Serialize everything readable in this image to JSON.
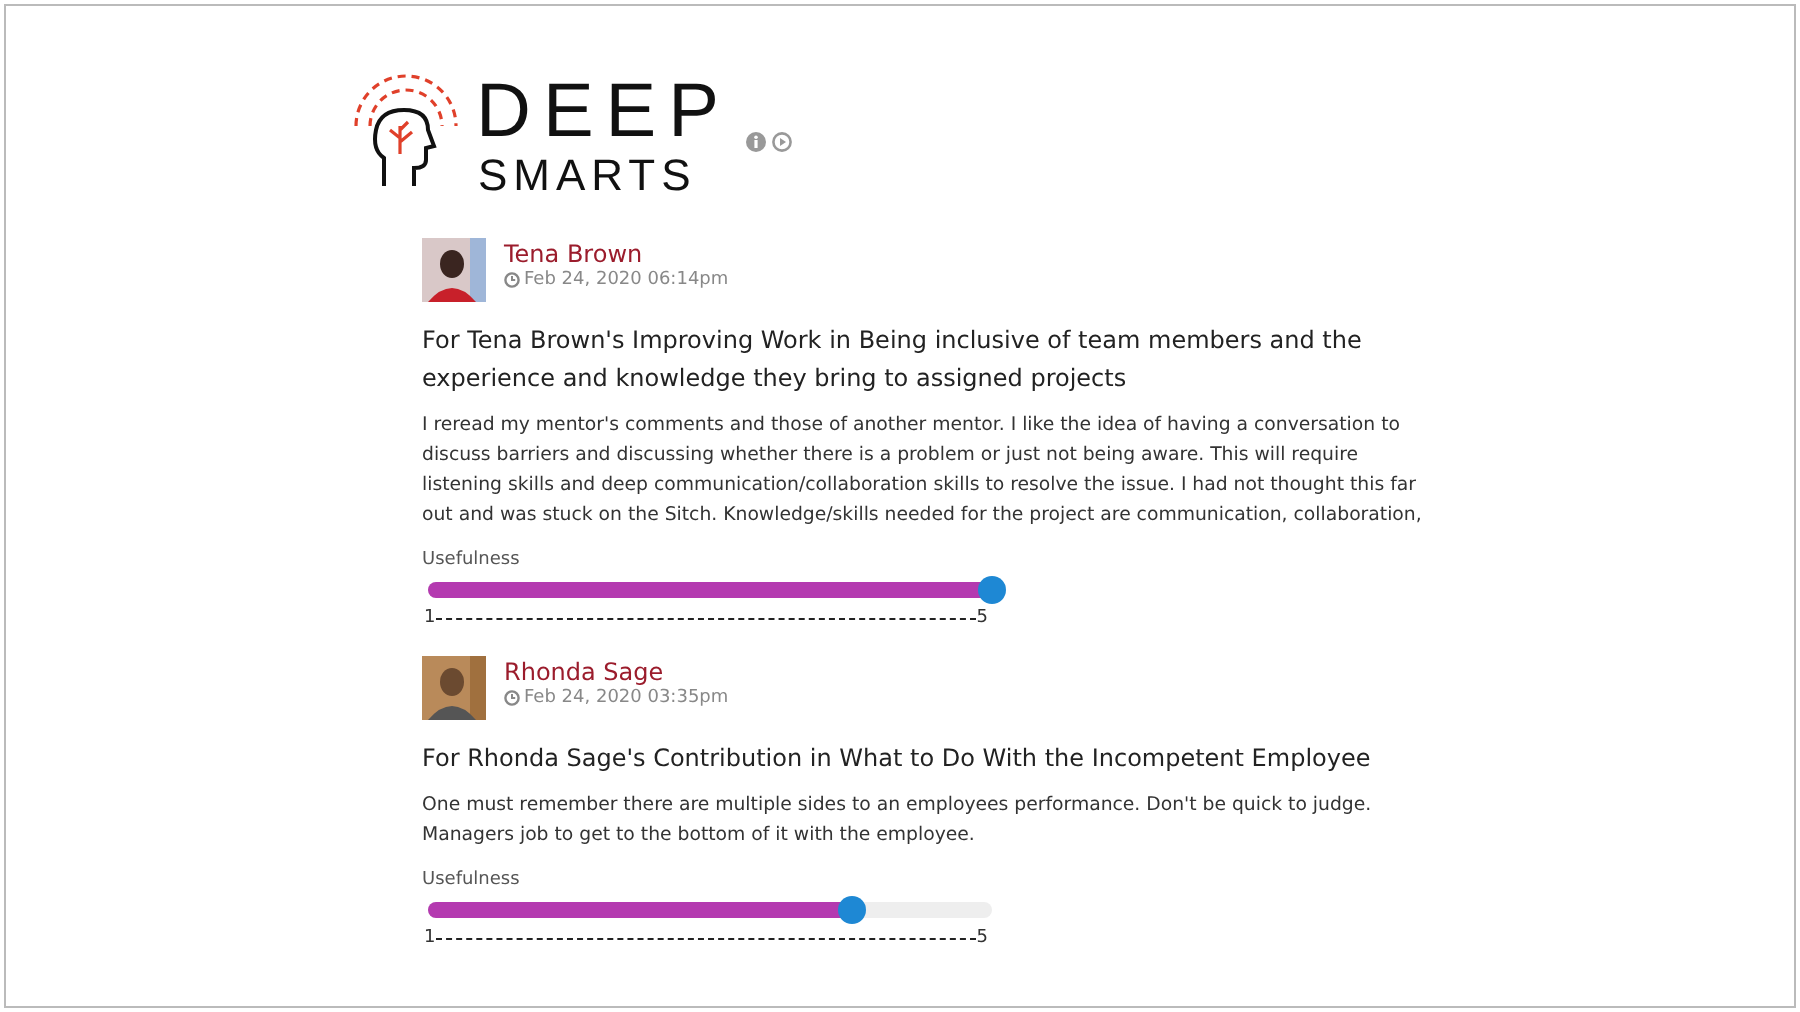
{
  "logo": {
    "line_1": "DEEP",
    "line_2": "SMARTS"
  },
  "posts": [
    {
      "author": "Tena Brown",
      "time": "Feb 24, 2020 06:14pm",
      "title": "For Tena Brown's Improving Work in Being inclusive of team members and the experience and knowledge they bring to assigned projects",
      "body": "I reread my mentor's comments and those of another mentor. I like the idea of having a conversation to discuss barriers and discussing whether there is a problem or just not being aware. This will require listening skills and deep communication/collaboration skills to resolve the issue. I had not thought this far out and was stuck on the Sitch. Knowledge/skills needed for the project are communication, collaboration,",
      "rating_label": "Usefulness",
      "level": 1,
      "min": "1",
      "max": "5"
    },
    {
      "author": "Rhonda Sage",
      "time": "Feb 24, 2020 03:35pm",
      "title": "For Rhonda Sage's Contribution in What to Do With the Incompetent Employee",
      "body": "One must remember there are multiple sides to an employees performance. Don't be quick to judge. Managers job to get to the bottom of it with the employee.",
      "rating_label": "Usefulness",
      "level": 0.75,
      "min": "1",
      "max": "5"
    }
  ]
}
